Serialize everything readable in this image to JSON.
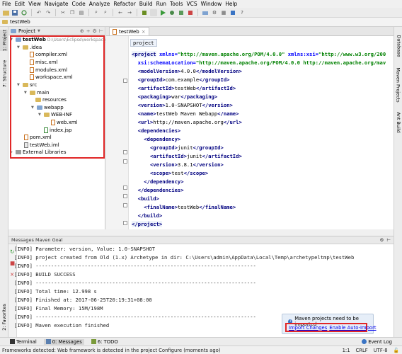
{
  "menu": [
    "File",
    "Edit",
    "View",
    "Navigate",
    "Code",
    "Analyze",
    "Refactor",
    "Build",
    "Run",
    "Tools",
    "VCS",
    "Window",
    "Help"
  ],
  "nav": {
    "project_name": "testWeb"
  },
  "left_stripe": {
    "project": "1: Project",
    "structure": "7: Structure",
    "favorites": "2: Favorites"
  },
  "right_stripe": {
    "database": "Database",
    "maven": "Maven Projects",
    "ant": "Ant Build"
  },
  "project_panel": {
    "header": "Project",
    "tree": [
      {
        "label": "testWeb",
        "suffix": "D:\\Users\\Eclipse\\workspace_lk",
        "type": "folder"
      },
      {
        "label": ".idea",
        "type": "folder"
      },
      {
        "label": "compiler.xml",
        "type": "xml"
      },
      {
        "label": "misc.xml",
        "type": "xml"
      },
      {
        "label": "modules.xml",
        "type": "xml"
      },
      {
        "label": "workspace.xml",
        "type": "xml"
      },
      {
        "label": "src",
        "type": "folder"
      },
      {
        "label": "main",
        "type": "folder"
      },
      {
        "label": "resources",
        "type": "folder"
      },
      {
        "label": "webapp",
        "type": "folder"
      },
      {
        "label": "WEB-INF",
        "type": "folder"
      },
      {
        "label": "web.xml",
        "type": "xml"
      },
      {
        "label": "index.jsp",
        "type": "jsp"
      },
      {
        "label": "pom.xml",
        "type": "xml"
      },
      {
        "label": "testWeb.iml",
        "type": "iml"
      },
      {
        "label": "External Libraries",
        "type": "lib"
      }
    ]
  },
  "editor": {
    "tab": "testWeb",
    "breadcrumb": "project",
    "lines": [
      [
        "<project",
        " xmlns=",
        "\"http://maven.apache.org/POM/4.0.0\"",
        " xmlns:xsi=",
        "\"http://www.w3.org/200"
      ],
      [
        "  xsi:schemaLocation=",
        "\"http://maven.apache.org/POM/4.0.0 http://maven.apache.org/mav"
      ],
      [
        "  <modelVersion>",
        "4.0.0",
        "</modelVersion>"
      ],
      [
        "  <groupId>",
        "com.example",
        "</groupId>"
      ],
      [
        "  <artifactId>",
        "testWeb",
        "</artifactId>"
      ],
      [
        "  <packaging>",
        "war",
        "</packaging>"
      ],
      [
        "  <version>",
        "1.0-SNAPSHOT",
        "</version>"
      ],
      [
        "  <name>",
        "testWeb Maven Webapp",
        "</name>"
      ],
      [
        "  <url>",
        "http://maven.apache.org",
        "</url>"
      ],
      [
        "  <dependencies>"
      ],
      [
        "    <dependency>"
      ],
      [
        "      <groupId>",
        "junit",
        "</groupId>"
      ],
      [
        "      <artifactId>",
        "junit",
        "</artifactId>"
      ],
      [
        "      <version>",
        "3.8.1",
        "</version>"
      ],
      [
        "      <scope>",
        "test",
        "</scope>"
      ],
      [
        "    </dependency>"
      ],
      [
        "  </dependencies>"
      ],
      [
        "  <build>"
      ],
      [
        "    <finalName>",
        "testWeb",
        "</finalName>"
      ],
      [
        "  </build>"
      ],
      [
        "</project>"
      ]
    ]
  },
  "messages": {
    "header": "Messages Maven Goal",
    "lines": [
      "[INFO] Parameter: version, Value: 1.0-SNAPSHOT",
      "[INFO] project created from Old (1.x) Archetype in dir: C:\\Users\\admin\\AppData\\Local\\Temp\\archetypeltmp\\testWeb",
      "[INFO] ------------------------------------------------------------------------",
      "[INFO] BUILD SUCCESS",
      "[INFO] ------------------------------------------------------------------------",
      "[INFO] Total time: 12.998 s",
      "[INFO] Finished at: 2017-06-25T20:19:31+08:00",
      "[INFO] Final Memory: 15M/198M",
      "[INFO] ------------------------------------------------------------------------",
      "[INFO] Maven execution finished"
    ]
  },
  "notification": {
    "title": "Maven projects need to be imported",
    "import": "Import Changes",
    "auto": "Enable Auto-Import"
  },
  "bottom_tools": {
    "terminal": "Terminal",
    "messages": "0: Messages",
    "todo": "6: TODO",
    "event_log": "Event Log"
  },
  "status": {
    "message": "Frameworks detected: Web framework is detected in the project Configure (moments ago)",
    "position": "1:1",
    "line_sep": "CRLF",
    "encoding": "UTF-8"
  },
  "colors": {
    "highlight": "#e12727",
    "tag": "#000080",
    "attr": "#0000ff",
    "value": "#008000"
  }
}
